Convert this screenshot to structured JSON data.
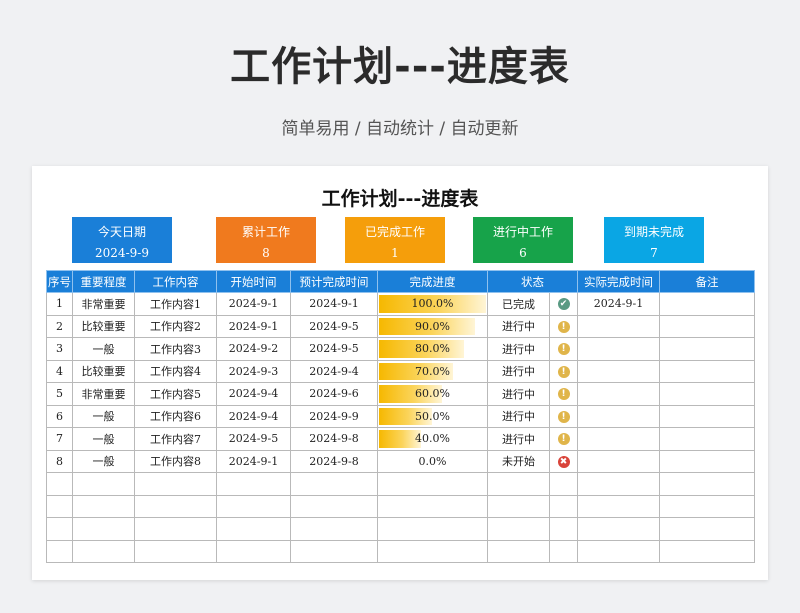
{
  "header": {
    "title": "工作计划---进度表",
    "subtitle": "简单易用  /  自动统计  /  自动更新"
  },
  "sheet": {
    "title": "工作计划---进度表",
    "cards": [
      {
        "label": "今天日期",
        "value": "2024-9-9",
        "color": "#1a7fd8"
      },
      {
        "label": "累计工作",
        "value": "8",
        "color": "#f07a1e"
      },
      {
        "label": "已完成工作",
        "value": "1",
        "color": "#f59e0b"
      },
      {
        "label": "进行中工作",
        "value": "6",
        "color": "#17a34a"
      },
      {
        "label": "到期未完成",
        "value": "7",
        "color": "#0aa6e4"
      }
    ],
    "columns": [
      "序号",
      "重要程度",
      "工作内容",
      "开始时间",
      "预计完成时间",
      "完成进度",
      "状态",
      "实际完成时间",
      "备注"
    ],
    "rows": [
      {
        "no": "1",
        "priority": "非常重要",
        "task": "工作内容1",
        "start": "2024-9-1",
        "due": "2024-9-1",
        "progress": 1.0,
        "progress_text": "100.0%",
        "status": "已完成",
        "status_icon": "check-circle-icon",
        "actual": "2024-9-1",
        "note": ""
      },
      {
        "no": "2",
        "priority": "比较重要",
        "task": "工作内容2",
        "start": "2024-9-1",
        "due": "2024-9-5",
        "progress": 0.9,
        "progress_text": "90.0%",
        "status": "进行中",
        "status_icon": "warning-circle-icon",
        "actual": "",
        "note": ""
      },
      {
        "no": "3",
        "priority": "一般",
        "task": "工作内容3",
        "start": "2024-9-2",
        "due": "2024-9-5",
        "progress": 0.8,
        "progress_text": "80.0%",
        "status": "进行中",
        "status_icon": "warning-circle-icon",
        "actual": "",
        "note": ""
      },
      {
        "no": "4",
        "priority": "比较重要",
        "task": "工作内容4",
        "start": "2024-9-3",
        "due": "2024-9-4",
        "progress": 0.7,
        "progress_text": "70.0%",
        "status": "进行中",
        "status_icon": "warning-circle-icon",
        "actual": "",
        "note": ""
      },
      {
        "no": "5",
        "priority": "非常重要",
        "task": "工作内容5",
        "start": "2024-9-4",
        "due": "2024-9-6",
        "progress": 0.6,
        "progress_text": "60.0%",
        "status": "进行中",
        "status_icon": "warning-circle-icon",
        "actual": "",
        "note": ""
      },
      {
        "no": "6",
        "priority": "一般",
        "task": "工作内容6",
        "start": "2024-9-4",
        "due": "2024-9-9",
        "progress": 0.5,
        "progress_text": "50.0%",
        "status": "进行中",
        "status_icon": "warning-circle-icon",
        "actual": "",
        "note": ""
      },
      {
        "no": "7",
        "priority": "一般",
        "task": "工作内容7",
        "start": "2024-9-5",
        "due": "2024-9-8",
        "progress": 0.4,
        "progress_text": "40.0%",
        "status": "进行中",
        "status_icon": "warning-circle-icon",
        "actual": "",
        "note": ""
      },
      {
        "no": "8",
        "priority": "一般",
        "task": "工作内容8",
        "start": "2024-9-1",
        "due": "2024-9-8",
        "progress": 0.0,
        "progress_text": "0.0%",
        "status": "未开始",
        "status_icon": "cross-circle-icon",
        "actual": "",
        "note": ""
      }
    ],
    "empty_rows": 4
  }
}
